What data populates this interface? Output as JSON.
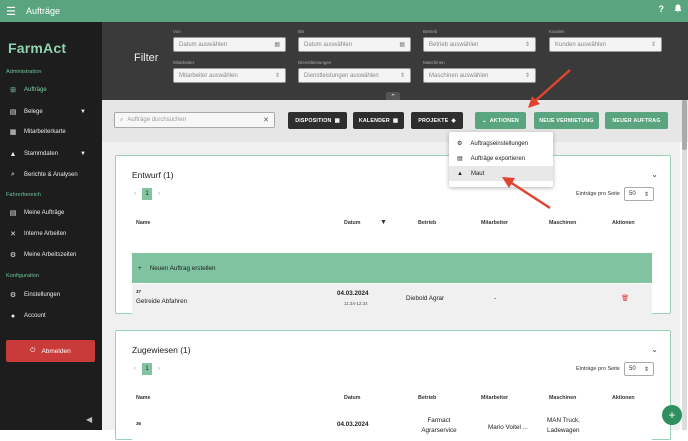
{
  "topbar": {
    "menu_icon": "☰",
    "title": "Aufträge",
    "help_icon": "?",
    "notifications_icon": "🔔"
  },
  "sidebar": {
    "logo": "FarmAct",
    "sections": [
      {
        "title": "Administration"
      },
      {
        "title": "Fahrerbereich"
      },
      {
        "title": "Konfiguration"
      }
    ],
    "items": [
      {
        "label": "Aufträge",
        "icon": "⊞"
      },
      {
        "label": "Belege",
        "icon": "▤"
      },
      {
        "label": "Mitarbeiterkarte",
        "icon": "▦"
      },
      {
        "label": "Stammdaten",
        "icon": "▲"
      },
      {
        "label": "Berichte & Analysen",
        "icon": "⌕"
      },
      {
        "label": "Meine Aufträge",
        "icon": "▤"
      },
      {
        "label": "Interne Arbeiten",
        "icon": "✕"
      },
      {
        "label": "Meine Arbeitszeiten",
        "icon": "⚙"
      },
      {
        "label": "Einstellungen",
        "icon": "⚙"
      },
      {
        "label": "Account",
        "icon": "●"
      }
    ],
    "logout": "Abmelden"
  },
  "filter": {
    "title": "Filter",
    "fields": [
      {
        "label": "Von",
        "placeholder": "Datum auswählen"
      },
      {
        "label": "Bis",
        "placeholder": "Datum auswählen"
      },
      {
        "label": "Betrieb",
        "placeholder": "Betrieb auswählen"
      },
      {
        "label": "Kunden",
        "placeholder": "Kunden auswählen"
      },
      {
        "label": "Mitarbeiter",
        "placeholder": "Mitarbeiter auswählen"
      },
      {
        "label": "Dienstleistungen",
        "placeholder": "Dienstleistungen auswählen"
      },
      {
        "label": "Maschinen",
        "placeholder": "Maschinen auswählen"
      }
    ]
  },
  "toolbar": {
    "search_placeholder": "Aufträge durchsuchen",
    "disposition": "DISPOSITION",
    "kalender": "KALENDER",
    "projekte": "PROJEKTE",
    "aktionen": "AKTIONEN",
    "neue_vermietung": "NEUE VERMIETUNG",
    "neuer_auftrag": "NEUER AUFTRAG"
  },
  "dropdown": {
    "items": [
      {
        "label": "Auftragseinstellungen",
        "icon": "⚙"
      },
      {
        "label": "Aufträge exportieren",
        "icon": "▤"
      },
      {
        "label": "Maut",
        "icon": "▲"
      }
    ]
  },
  "table": {
    "headers": [
      "Name",
      "Datum",
      "Betrieb",
      "Mitarbeiter",
      "Maschinen",
      "Aktionen"
    ],
    "per_page_label": "Einträge pro Seite",
    "per_page_value": "50"
  },
  "cards": [
    {
      "title": "Entwurf (1)",
      "page": "1",
      "new_row": "Neuen Auftrag erstellen",
      "rows": [
        {
          "num": "37",
          "name": "Getreide Abfahren",
          "date": "04.03.2024",
          "time": "11:34-12:34",
          "betrieb": "Diebold Agrar",
          "mitarbeiter": "-"
        }
      ]
    },
    {
      "title": "Zugewiesen (1)",
      "page": "1",
      "rows": [
        {
          "num": "36",
          "name": "",
          "date": "04.03.2024",
          "betrieb": "Farmact Agrarservice",
          "mitarbeiter": "Mario Voitel ...",
          "maschinen": "MAN Truck, Ladewagen"
        }
      ]
    }
  ],
  "colors": {
    "primary": "#5aa57f",
    "sidebar": "#1d1d1d",
    "danger": "#c93a3a",
    "arrow": "#e0442f"
  }
}
